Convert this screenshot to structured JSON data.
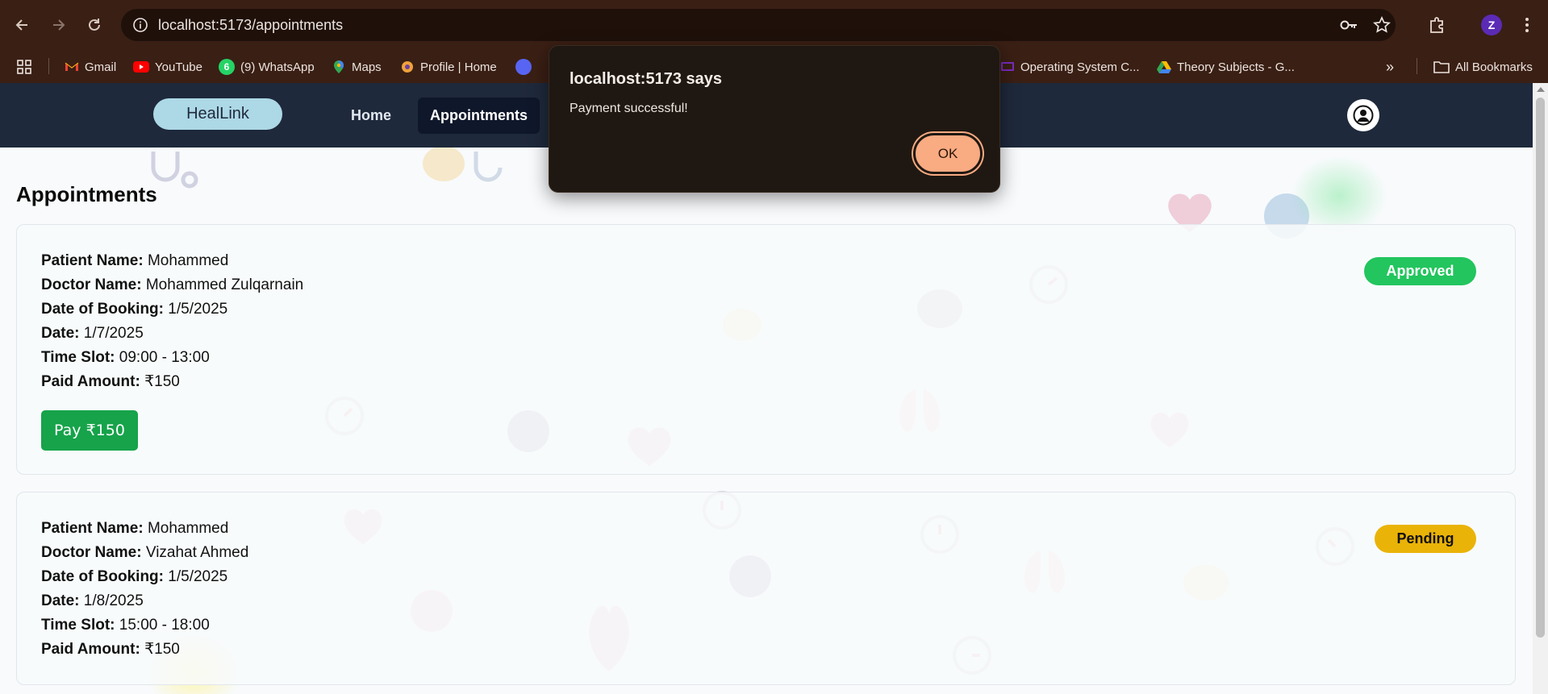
{
  "browser": {
    "url": "localhost:5173/appointments",
    "profile_initial": "Z",
    "bookmarks": [
      {
        "label": "Gmail",
        "icon": "gmail-icon"
      },
      {
        "label": "YouTube",
        "icon": "youtube-icon"
      },
      {
        "label": "(9) WhatsApp",
        "icon": "whatsapp-icon",
        "badge": "6"
      },
      {
        "label": "Maps",
        "icon": "maps-icon"
      },
      {
        "label": "Profile | Home",
        "icon": "profile-site-icon"
      },
      {
        "label": "Operating System C...",
        "icon": "operating-system-icon"
      },
      {
        "label": "Theory Subjects - G...",
        "icon": "google-drive-icon"
      }
    ],
    "all_bookmarks_label": "All Bookmarks"
  },
  "app": {
    "logo": "HealLink",
    "nav": {
      "home": "Home",
      "appointments": "Appointments"
    }
  },
  "page": {
    "title": "Appointments",
    "field_labels": {
      "patient": "Patient Name:",
      "doctor": "Doctor Name:",
      "booking": "Date of Booking:",
      "date": "Date:",
      "slot": "Time Slot:",
      "paid": "Paid Amount:"
    },
    "appointments": [
      {
        "patient": "Mohammed",
        "doctor": "Mohammed Zulqarnain",
        "booking": "1/5/2025",
        "date": "1/7/2025",
        "slot": "09:00 - 13:00",
        "paid": "₹150",
        "status": "Approved",
        "pay_label": "Pay ₹150"
      },
      {
        "patient": "Mohammed",
        "doctor": "Vizahat Ahmed",
        "booking": "1/5/2025",
        "date": "1/8/2025",
        "slot": "15:00 - 18:00",
        "paid": "₹150",
        "status": "Pending"
      }
    ]
  },
  "dialog": {
    "title": "localhost:5173 says",
    "message": "Payment successful!",
    "ok_label": "OK"
  },
  "colors": {
    "header_bg": "#1e293b",
    "approved": "#22c55e",
    "pending": "#eab308",
    "pay_button": "#16a34a",
    "dialog_ok": "#f9ab82"
  }
}
